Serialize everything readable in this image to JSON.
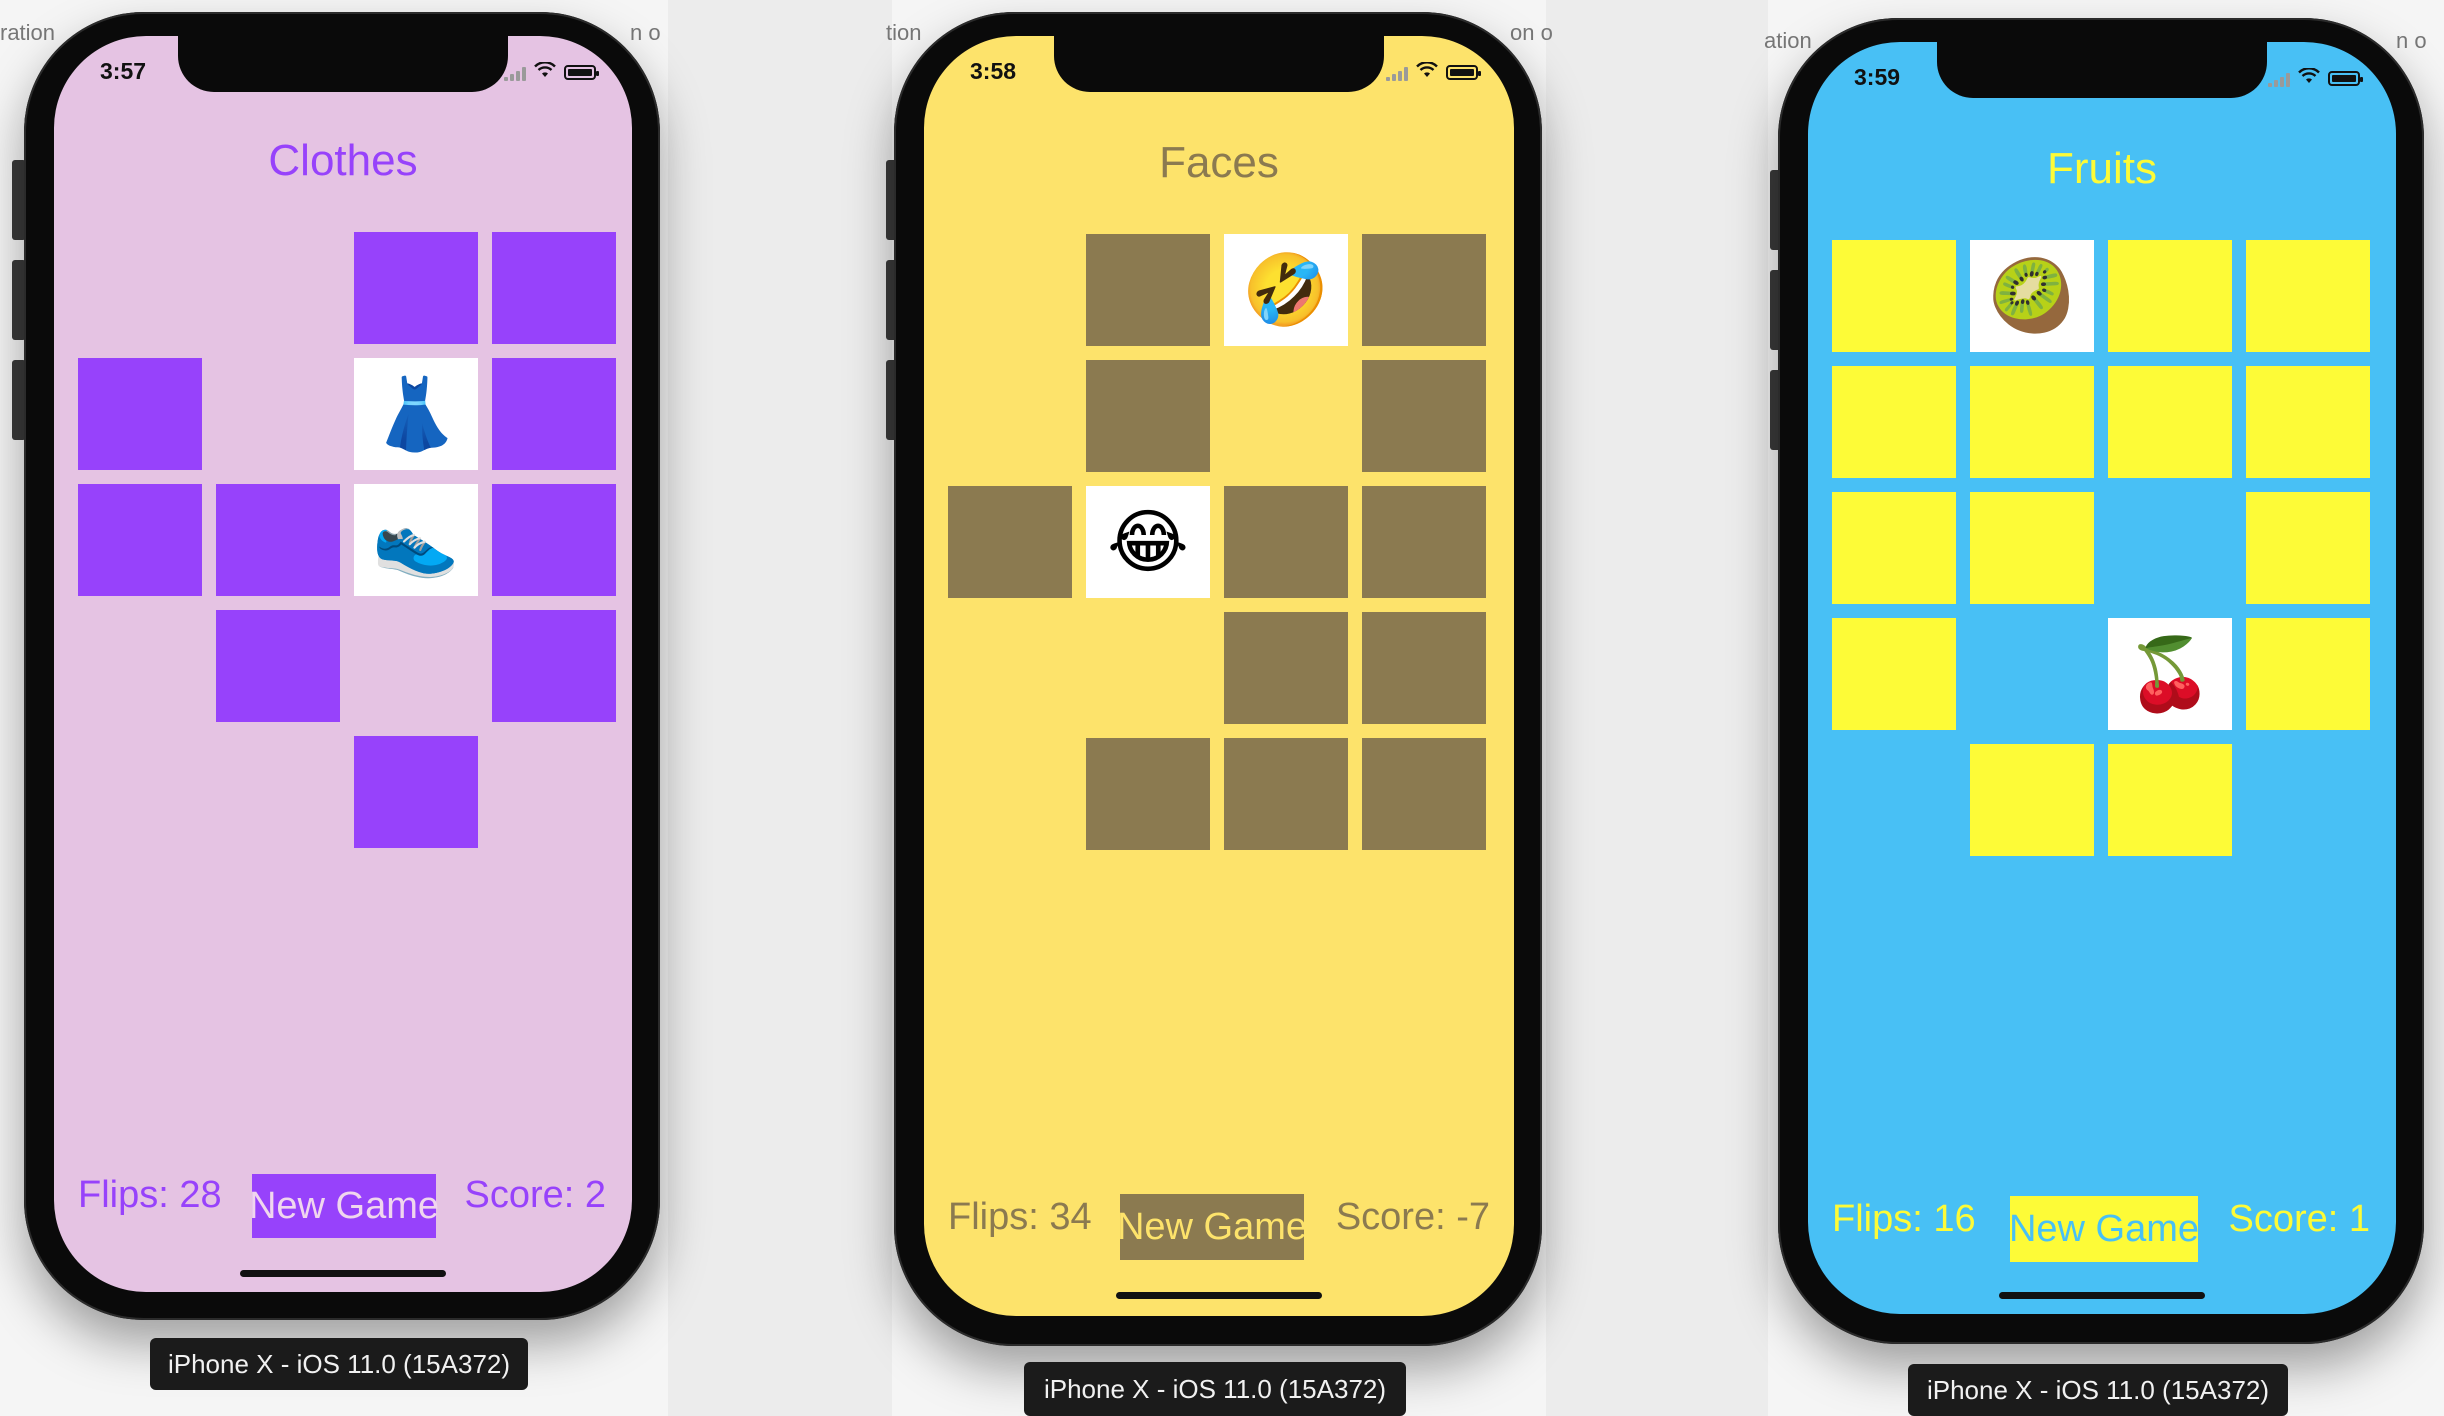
{
  "simulators": [
    {
      "time": "3:57",
      "theme": "Clothes",
      "background": "#e5c3e3",
      "card_back": "#9742fb",
      "text_color": "#9742fb",
      "button_text": "#f0d6ee",
      "flips": "Flips: 28",
      "new_game": "New Game",
      "score": "Score: 2",
      "device_caption": "iPhone X - iOS 11.0 (15A372)",
      "cards": [
        [
          "",
          "",
          "down",
          "down"
        ],
        [
          "down",
          "",
          "👗",
          "down"
        ],
        [
          "down",
          "down",
          "👟",
          "down"
        ],
        [
          "",
          "down",
          "",
          "down"
        ],
        [
          "",
          "",
          "down",
          ""
        ]
      ]
    },
    {
      "time": "3:58",
      "theme": "Faces",
      "background": "#fde36b",
      "card_back": "#8b7a50",
      "text_color": "#8b7a50",
      "button_text": "#fde36b",
      "flips": "Flips: 34",
      "new_game": "New Game",
      "score": "Score: -7",
      "device_caption": "iPhone X - iOS 11.0 (15A372)",
      "cards": [
        [
          "",
          "down",
          "🤣",
          "down"
        ],
        [
          "",
          "down",
          "",
          "down"
        ],
        [
          "down",
          "😂",
          "down",
          "down"
        ],
        [
          "",
          "",
          "down",
          "down"
        ],
        [
          "",
          "down",
          "down",
          "down"
        ]
      ]
    },
    {
      "time": "3:59",
      "theme": "Fruits",
      "background": "#48c0f5",
      "card_back": "#fdfb37",
      "text_color": "#fdfb37",
      "button_text": "#48c0f5",
      "flips": "Flips: 16",
      "new_game": "New Game",
      "score": "Score: 1",
      "device_caption": "iPhone X - iOS 11.0 (15A372)",
      "cards": [
        [
          "down",
          "🥝",
          "down",
          "down"
        ],
        [
          "down",
          "down",
          "down",
          "down"
        ],
        [
          "down",
          "down",
          "",
          "down"
        ],
        [
          "down",
          "",
          "🍒",
          "down"
        ],
        [
          "",
          "down",
          "down",
          ""
        ]
      ]
    }
  ],
  "background_fragments": [
    "ration",
    "n o",
    "tion",
    "on o",
    "ation",
    "n o"
  ]
}
